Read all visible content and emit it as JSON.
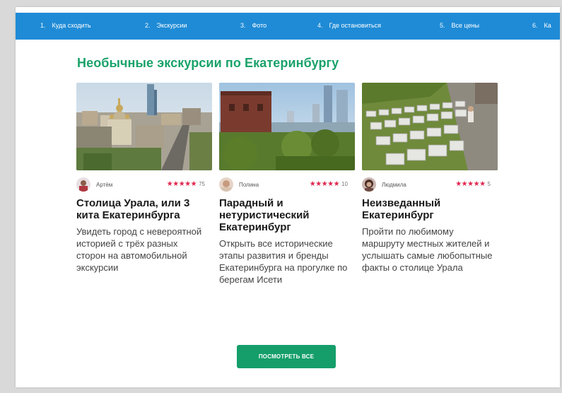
{
  "nav": {
    "items": [
      {
        "num": "1.",
        "label": "Куда сходить"
      },
      {
        "num": "2.",
        "label": "Экскурсии"
      },
      {
        "num": "3.",
        "label": "Фото"
      },
      {
        "num": "4.",
        "label": "Где остановиться"
      },
      {
        "num": "5.",
        "label": "Все цены"
      },
      {
        "num": "6.",
        "label": "Ка"
      }
    ]
  },
  "section": {
    "title": "Необычные экскурсии по Екатеринбургу",
    "see_all_label": "посмотреть все"
  },
  "colors": {
    "nav_bg": "#1f8bd6",
    "title_green": "#1aa26a",
    "button_green": "#159e6a",
    "star_red": "#e0264d"
  },
  "cards": [
    {
      "author": "Артём",
      "stars": "★★★★★",
      "reviews": "75",
      "title": "Столица Урала, или 3 кита Екатеринбурга",
      "description": "Увидеть город с невероятной историей с трёх разных сторон на автомобильной экскурсии"
    },
    {
      "author": "Полина",
      "stars": "★★★★★",
      "reviews": "10",
      "title": "Парадный и нетуристический Екатеринбург",
      "description": "Открыть все исторические этапы развития и бренды Екатеринбурга на прогулке по берегам Исети"
    },
    {
      "author": "Людмила",
      "stars": "★★★★★",
      "reviews": "5",
      "title": "Неизведанный Екатеринбург",
      "description": "Пройти по любимому маршруту местных жителей и услышать самые любопытные факты о столице Урала"
    }
  ]
}
